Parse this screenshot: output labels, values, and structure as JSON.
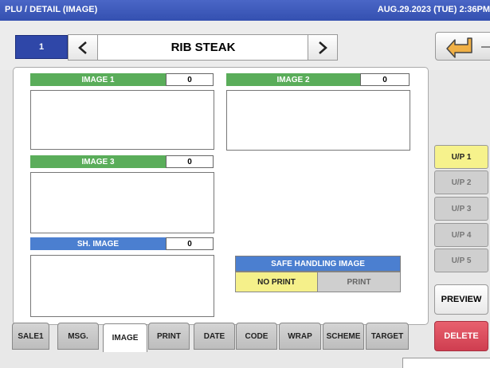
{
  "title": "PLU / DETAIL (IMAGE)",
  "datetime": "AUG.29.2023 (TUE)  2:36PM",
  "plu": {
    "number": "1",
    "name": "RIB STEAK"
  },
  "images": [
    {
      "label": "IMAGE 1",
      "count": "0"
    },
    {
      "label": "IMAGE 2",
      "count": "0"
    },
    {
      "label": "IMAGE 3",
      "count": "0"
    },
    {
      "label": "SH. IMAGE",
      "count": "0"
    }
  ],
  "safe_handling": {
    "title": "SAFE HANDLING IMAGE",
    "selected": "NO PRINT",
    "other": "PRINT"
  },
  "side_buttons": [
    "U/P 1",
    "U/P 2",
    "U/P 3",
    "U/P 4",
    "U/P 5"
  ],
  "preview_label": "PREVIEW",
  "delete_label": "DELETE",
  "tabs": [
    "SALE1",
    "MSG.",
    "IMAGE",
    "PRINT",
    "DATE",
    "CODE",
    "WRAP",
    "SCHEME",
    "TARGET"
  ],
  "active_tab": "IMAGE",
  "colors": {
    "title_bar": "#3f5cc0",
    "green_header": "#5aad5a",
    "blue_header": "#4b7fd0",
    "selected_yellow": "#f6f28c",
    "delete_red": "#d6475a"
  },
  "icons": {
    "prev": "chevron-left-icon",
    "next": "chevron-right-icon",
    "back": "return-arrow-icon"
  }
}
